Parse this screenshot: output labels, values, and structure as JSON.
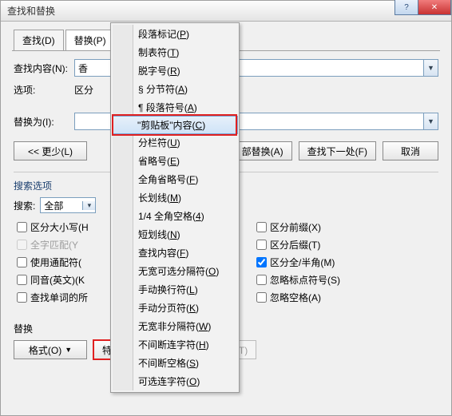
{
  "title": "查找和替换",
  "window_buttons": {
    "help": "?",
    "close": "✕"
  },
  "tabs": [
    {
      "label": "查找(D)"
    },
    {
      "label": "替换(P)"
    }
  ],
  "fields": {
    "find_label": "查找内容(N):",
    "find_value": "香",
    "options_label": "选项:",
    "options_value": "区分",
    "replace_label": "替换为(I):",
    "replace_value": ""
  },
  "buttons": {
    "less": "<< 更少(L)",
    "replace_all_partial": "部替换(A)",
    "find_next": "查找下一处(F)",
    "cancel": "取消"
  },
  "search_options": {
    "group_title": "搜索选项",
    "search_label": "搜索:",
    "direction": "全部"
  },
  "checks_left": [
    {
      "label": "区分大小写(H)",
      "checked": false,
      "disabled": false,
      "trunc": "区分大小写(H"
    },
    {
      "label": "全字匹配(Y)",
      "checked": false,
      "disabled": true,
      "trunc": "全字匹配(Y"
    },
    {
      "label": "使用通配符(U)",
      "checked": false,
      "disabled": false,
      "trunc": "使用通配符("
    },
    {
      "label": "同音(英文)(K)",
      "checked": false,
      "disabled": false,
      "trunc": "同音(英文)(K"
    },
    {
      "label": "查找单词的所",
      "checked": false,
      "disabled": false,
      "trunc": "查找单词的所"
    }
  ],
  "checks_right": [
    {
      "label": "区分前缀(X)",
      "checked": false
    },
    {
      "label": "区分后缀(T)",
      "checked": false
    },
    {
      "label": "区分全/半角(M)",
      "checked": true
    },
    {
      "label": "忽略标点符号(S)",
      "checked": false
    },
    {
      "label": "忽略空格(A)",
      "checked": false
    }
  ],
  "bottom": {
    "group": "替换",
    "format": "格式(O)",
    "special": "特殊格式(E)",
    "noformat": "不限定格式(T)"
  },
  "menu": [
    {
      "t": "段落标记(",
      "u": "P",
      "r": ")"
    },
    {
      "t": "制表符(",
      "u": "T",
      "r": ")"
    },
    {
      "t": "脱字号(",
      "u": "R",
      "r": ")"
    },
    {
      "t": "§ 分节符(",
      "u": "A",
      "r": ")"
    },
    {
      "t": "¶ 段落符号(",
      "u": "A",
      "r": ")"
    },
    {
      "t": "\"剪贴板\"内容(",
      "u": "C",
      "r": ")",
      "hover": true
    },
    {
      "t": "分栏符(",
      "u": "U",
      "r": ")"
    },
    {
      "t": "省略号(",
      "u": "E",
      "r": ")"
    },
    {
      "t": "全角省略号(",
      "u": "F",
      "r": ")"
    },
    {
      "t": "长划线(",
      "u": "M",
      "r": ")"
    },
    {
      "t": "1/4 全角空格(",
      "u": "4",
      "r": ")"
    },
    {
      "t": "短划线(",
      "u": "N",
      "r": ")"
    },
    {
      "t": "查找内容(",
      "u": "F",
      "r": ")"
    },
    {
      "t": "无宽可选分隔符(",
      "u": "O",
      "r": ")"
    },
    {
      "t": "手动换行符(",
      "u": "L",
      "r": ")"
    },
    {
      "t": "手动分页符(",
      "u": "K",
      "r": ")"
    },
    {
      "t": "无宽非分隔符(",
      "u": "W",
      "r": ")"
    },
    {
      "t": "不间断连字符(",
      "u": "H",
      "r": ")"
    },
    {
      "t": "不间断空格(",
      "u": "S",
      "r": ")"
    },
    {
      "t": "可选连字符(",
      "u": "O",
      "r": ")"
    }
  ]
}
